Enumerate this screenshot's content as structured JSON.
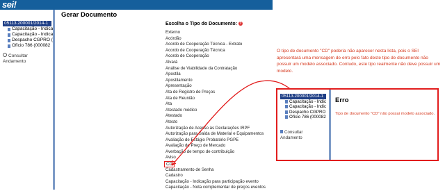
{
  "header": {
    "logo": "sei!"
  },
  "tree": {
    "root": "05113.200001/2014-1",
    "items": [
      "Capacitação - Indica",
      "Capacitação - Indica",
      "Despacho CGPRO (",
      "Ofício 786 (000082"
    ]
  },
  "sidebar": {
    "consult_line1": "Consultar",
    "consult_line2": "Andamento"
  },
  "main": {
    "title": "Gerar Documento",
    "choose_label": "Escolha o Tipo do Documento:",
    "help_mark": "?",
    "doc_types": [
      "Externo",
      "Acórdão",
      "Acordo de Cooperação Técnica - Extrato",
      "Acordo de Cooperação Técnica",
      "Acordo de Cooperação",
      "Alvará",
      "Análise de Viabilidade da Contratação",
      "Apostila",
      "Apostilamento",
      "Apresentação",
      "Ata de Registro de Preços",
      "Ata de Reunião",
      "Ata",
      "Atestado médico",
      "Atestado",
      "Atesto",
      "Autorização de Acesso às Declarações IRPF",
      "Autorização para Saída de Material e Equipamentos",
      "Avaliação de Estágio Probatório PGPE",
      "Avaliação de Preço de Mercado",
      "Averbação de tempo de contribuição",
      "Aviso",
      "CD",
      "Cadastramento de Senha",
      "Cadastro",
      "Capacitação - Indicação para participação evento",
      "Capacitação - Nota complementar de preços eventos"
    ],
    "highlighted_index": 22
  },
  "annotation": {
    "note": "O tipo de documento \"CD\" poderia não aparecer nesta lista, pois o SEI apresentará uma mensagem de erro pelo fato deste tipo de documento não possuir um modelo associado. Contudo, este tipo realmente não deve possuir um modelo."
  },
  "popup": {
    "tree_root": "05113.200001/2014-1",
    "tree_items": [
      "Capacitação - Indic",
      "Capacitação - Indic",
      "Despacho CGPRO",
      "Ofício 786 (000082"
    ],
    "consult_line1": "Consultar",
    "consult_line2": "Andamento",
    "error_title": "Erro",
    "error_message": "Tipo de documento \"CD\" não possui modelo associado."
  },
  "colors": {
    "header_blue": "#155f9c",
    "selection_blue": "#1f3f86",
    "annotation_red": "#d5361b",
    "highlight_red": "#e21d1d"
  }
}
